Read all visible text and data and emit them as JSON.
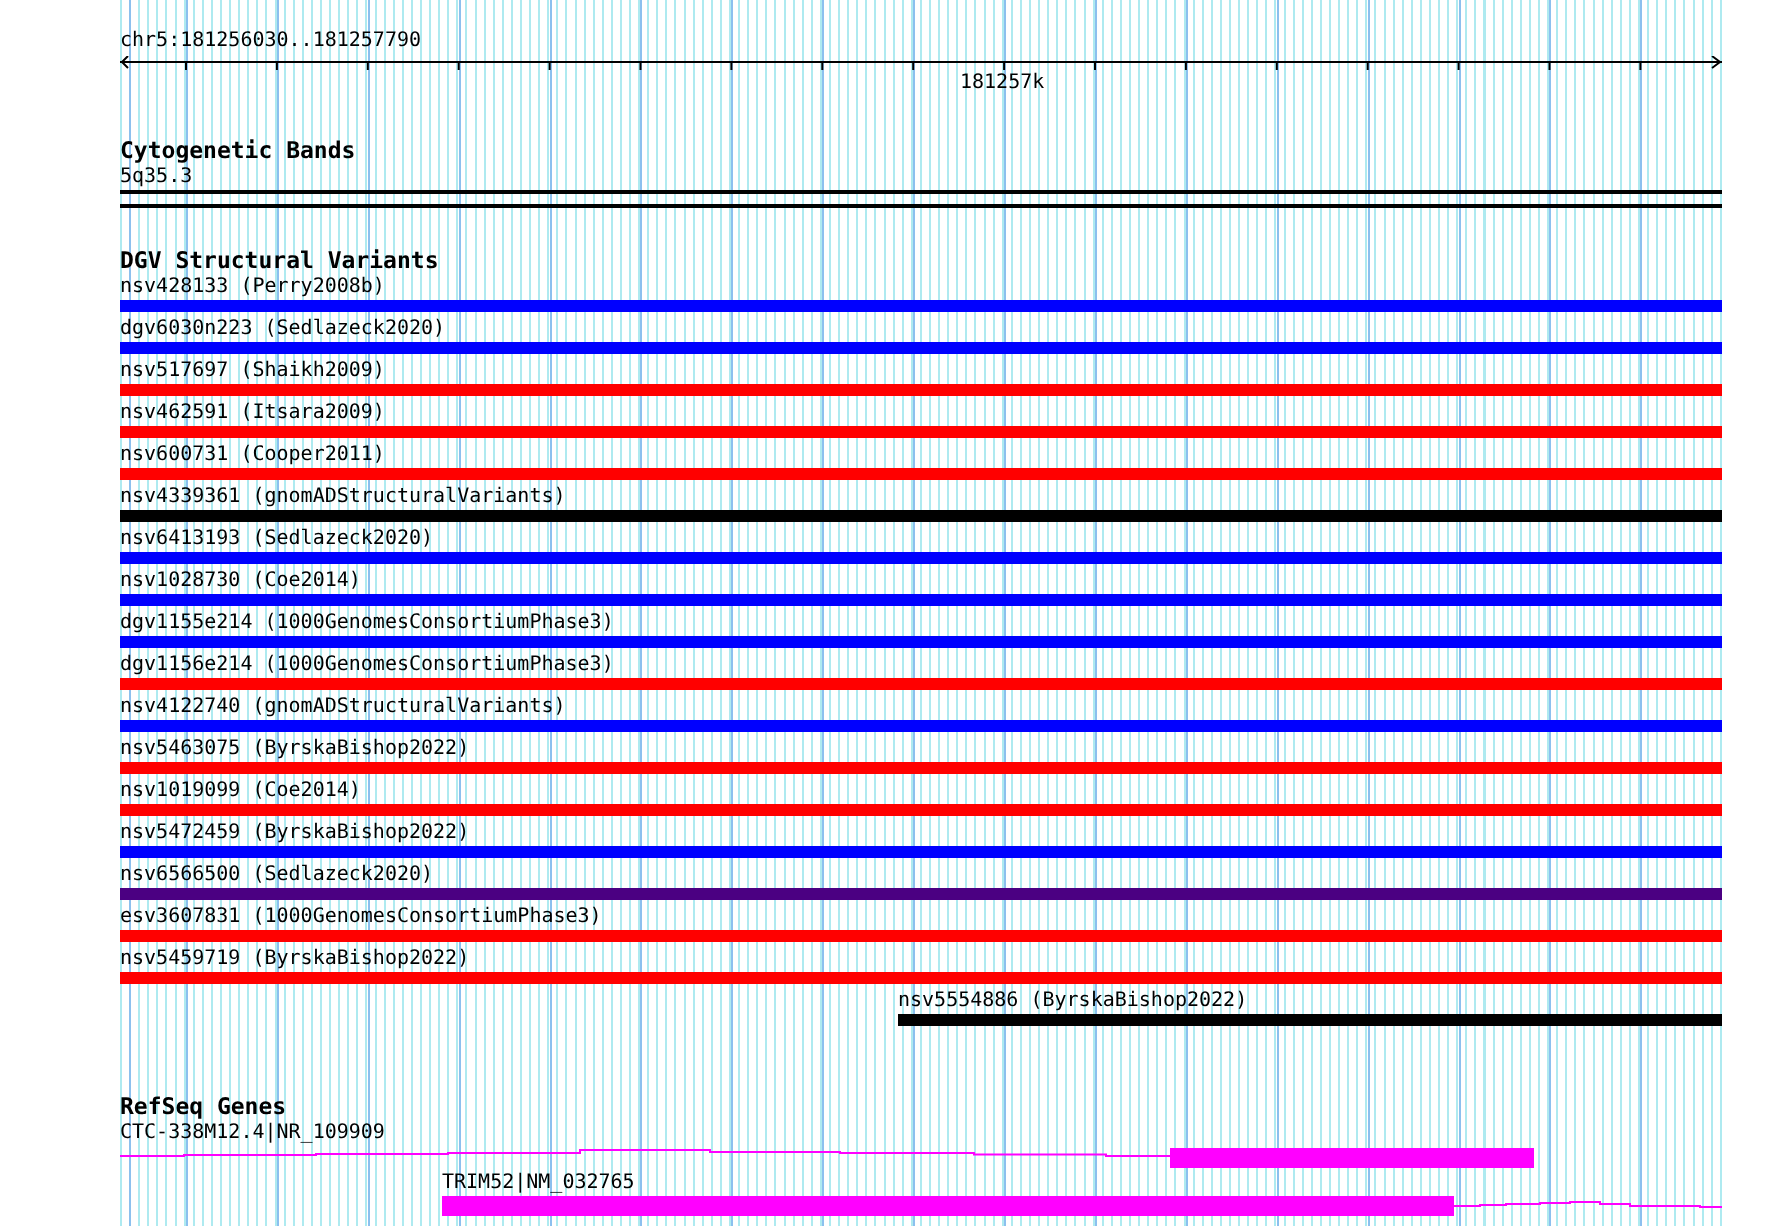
{
  "location": "chr5:181256030..181257790",
  "ruler": {
    "tick_label": "181257k"
  },
  "tracks": [
    {
      "kind": "cytoband",
      "title": "Cytogenetic Bands",
      "features": [
        {
          "label": "5q35.3"
        }
      ]
    },
    {
      "kind": "variants",
      "title": "DGV Structural Variants",
      "features": [
        {
          "label": "nsv428133 (Perry2008b)",
          "color": "#0000ff"
        },
        {
          "label": "dgv6030n223 (Sedlazeck2020)",
          "color": "#0000ff"
        },
        {
          "label": "nsv517697 (Shaikh2009)",
          "color": "#ff0000"
        },
        {
          "label": "nsv462591 (Itsara2009)",
          "color": "#ff0000"
        },
        {
          "label": "nsv600731 (Cooper2011)",
          "color": "#ff0000"
        },
        {
          "label": "nsv4339361 (gnomADStructuralVariants)",
          "color": "#000000"
        },
        {
          "label": "nsv6413193 (Sedlazeck2020)",
          "color": "#0000ff"
        },
        {
          "label": "nsv1028730 (Coe2014)",
          "color": "#0000ff"
        },
        {
          "label": "dgv1155e214 (1000GenomesConsortiumPhase3)",
          "color": "#0000ff"
        },
        {
          "label": "dgv1156e214 (1000GenomesConsortiumPhase3)",
          "color": "#ff0000"
        },
        {
          "label": "nsv4122740 (gnomADStructuralVariants)",
          "color": "#0000ff"
        },
        {
          "label": "nsv5463075 (ByrskaBishop2022)",
          "color": "#ff0000"
        },
        {
          "label": "nsv1019099 (Coe2014)",
          "color": "#ff0000"
        },
        {
          "label": "nsv5472459 (ByrskaBishop2022)",
          "color": "#0000ff"
        },
        {
          "label": "nsv6566500 (Sedlazeck2020)",
          "color": "#4b0082"
        },
        {
          "label": "esv3607831 (1000GenomesConsortiumPhase3)",
          "color": "#ff0000"
        },
        {
          "label": "nsv5459719 (ByrskaBishop2022)",
          "color": "#ff0000"
        },
        {
          "label": "nsv5554886 (ByrskaBishop2022)",
          "color": "#000000"
        }
      ]
    },
    {
      "kind": "genes",
      "title": "RefSeq Genes",
      "features": [
        {
          "label": "CTC-338M12.4|NR_109909"
        },
        {
          "label": "TRIM52|NM_032765"
        }
      ]
    }
  ]
}
